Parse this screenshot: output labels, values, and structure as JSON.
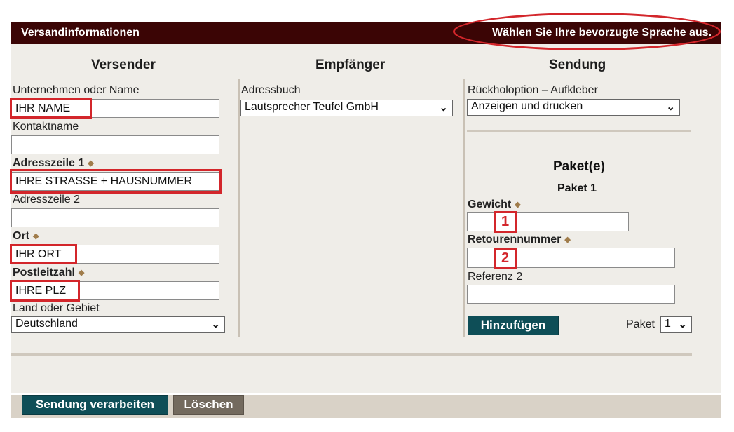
{
  "header": {
    "title": "Versandinformationen",
    "language_link": "Wählen Sie Ihre bevorzugte Sprache aus."
  },
  "columns": {
    "sender": "Versender",
    "recipient": "Empfänger",
    "shipment": "Sendung"
  },
  "sender": {
    "company_label": "Unternehmen oder Name",
    "company_value": "IHR NAME",
    "contact_label": "Kontaktname",
    "contact_value": "",
    "address1_label": "Adresszeile 1",
    "address1_value": "IHRE STRASSE + HAUSNUMMER",
    "address2_label": "Adresszeile 2",
    "address2_value": "",
    "city_label": "Ort",
    "city_value": "IHR ORT",
    "zip_label": "Postleitzahl",
    "zip_value": "IHRE PLZ",
    "country_label": "Land oder Gebiet",
    "country_value": "Deutschland"
  },
  "recipient": {
    "addressbook_label": "Adressbuch",
    "addressbook_value": "Lautsprecher Teufel GmbH"
  },
  "shipment": {
    "return_label": "Rückholoption – Aufkleber",
    "return_value": "Anzeigen und drucken",
    "packages_title": "Paket(e)",
    "package_title": "Paket 1",
    "weight_label": "Gewicht",
    "weight_value": "",
    "weight_marker": "1",
    "return_number_label": "Retourennummer",
    "return_number_value": "",
    "return_number_marker": "2",
    "reference_label": "Referenz 2",
    "reference_value": "",
    "add_button": "Hinzufügen",
    "package_select_label": "Paket",
    "package_select_value": "1"
  },
  "footer": {
    "process_button": "Sendung verarbeiten",
    "delete_button": "Löschen"
  },
  "required_marker": "◆"
}
